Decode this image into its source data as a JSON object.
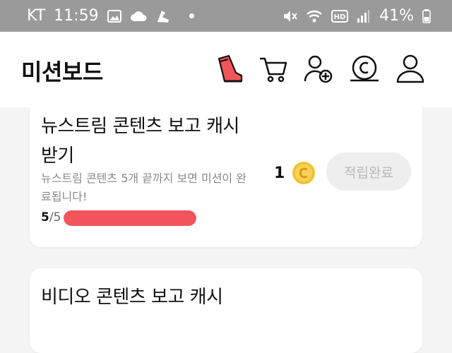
{
  "status_bar": {
    "carrier": "KT",
    "time": "11:59",
    "battery_percent": "41%",
    "icons": [
      "image-icon",
      "cloud-icon",
      "shoe-notification-icon",
      "dot-icon",
      "mute-icon",
      "wifi-icon",
      "hd-icon",
      "signal-icon",
      "battery-icon"
    ]
  },
  "header": {
    "title": "미션보드",
    "icons": [
      "shoe-icon",
      "cart-icon",
      "add-friend-icon",
      "coin-wallet-icon",
      "profile-icon"
    ]
  },
  "missions": [
    {
      "title": "뉴스트림 콘텐츠 보고 캐시 받기",
      "description": "뉴스트림 콘텐츠 5개 끝까지 보면 미션이 완료됩니다!",
      "progress_current": "5",
      "progress_total": "/5",
      "progress_fraction": 1.0,
      "reward_amount": "1",
      "button_label": "적립완료"
    },
    {
      "title": "비디오 콘텐츠 보고 캐시"
    }
  ],
  "colors": {
    "accent": "#f2545b",
    "coin": "#f2c233",
    "status_bar": "#9a9a9a"
  }
}
